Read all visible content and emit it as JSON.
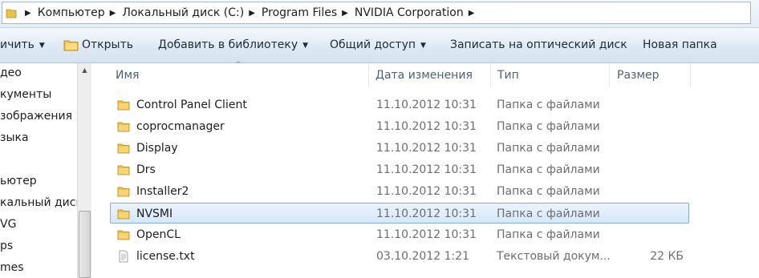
{
  "address": {
    "crumbs": [
      "Компьютер",
      "Локальный диск (C:)",
      "Program Files",
      "NVIDIA Corporation"
    ]
  },
  "toolbar": {
    "organize_label": "ичить",
    "open_label": "Открыть",
    "library_label": "Добавить в библиотеку",
    "share_label": "Общий доступ",
    "burn_label": "Записать на оптический диск",
    "new_folder_label": "Новая папка"
  },
  "nav": {
    "items": [
      "део",
      "кументы",
      "зображения",
      "зыка",
      "",
      "ьютер",
      "кальный диск (С",
      "VG",
      "ps",
      "mes"
    ]
  },
  "columns": {
    "name": "Имя",
    "date": "Дата изменения",
    "type": "Тип",
    "size": "Размер"
  },
  "files": [
    {
      "name": "Control Panel Client",
      "date": "11.10.2012 10:31",
      "type": "Папка с файлами",
      "size": "",
      "icon": "folder-icon"
    },
    {
      "name": "coprocmanager",
      "date": "11.10.2012 10:31",
      "type": "Папка с файлами",
      "size": "",
      "icon": "folder-icon"
    },
    {
      "name": "Display",
      "date": "11.10.2012 10:31",
      "type": "Папка с файлами",
      "size": "",
      "icon": "folder-icon"
    },
    {
      "name": "Drs",
      "date": "11.10.2012 10:31",
      "type": "Папка с файлами",
      "size": "",
      "icon": "folder-icon"
    },
    {
      "name": "Installer2",
      "date": "11.10.2012 10:31",
      "type": "Папка с файлами",
      "size": "",
      "icon": "folder-icon"
    },
    {
      "name": "NVSMI",
      "date": "11.10.2012 10:31",
      "type": "Папка с файлами",
      "size": "",
      "icon": "folder-icon",
      "selected": true
    },
    {
      "name": "OpenCL",
      "date": "11.10.2012 10:31",
      "type": "Папка с файлами",
      "size": "",
      "icon": "folder-icon"
    },
    {
      "name": "license.txt",
      "date": "03.10.2012 1:21",
      "type": "Текстовый докум...",
      "size": "22 КБ",
      "icon": "text-file-icon"
    }
  ],
  "colors": {
    "selection_border": "#84acdd",
    "header_text": "#4c607a",
    "folder_yellow": "#f2c94c"
  }
}
